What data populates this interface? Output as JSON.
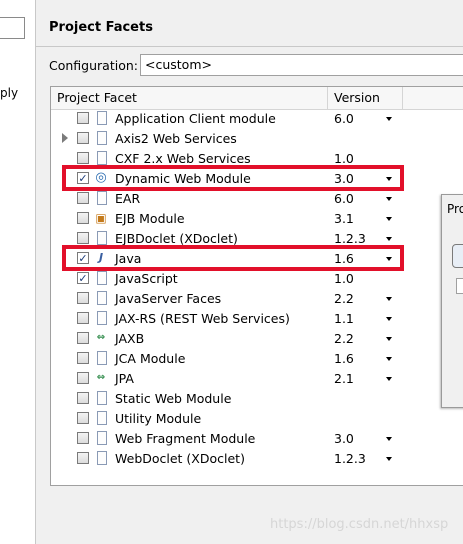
{
  "left_panel": {
    "partial_text": "ply"
  },
  "page": {
    "title": "Project Facets"
  },
  "configuration": {
    "label": "Configuration:",
    "value": "<custom>"
  },
  "table": {
    "headers": {
      "facet": "Project Facet",
      "version": "Version"
    },
    "rows": [
      {
        "label": "Application Client module",
        "version": "6.0",
        "checked": false,
        "icon": "doc-icon",
        "dropdown": true
      },
      {
        "label": "Axis2 Web Services",
        "version": "",
        "checked": false,
        "icon": "doc-icon",
        "expandable": true
      },
      {
        "label": "CXF 2.x Web Services",
        "version": "1.0",
        "checked": false,
        "icon": "doc-icon"
      },
      {
        "label": "Dynamic Web Module",
        "version": "3.0",
        "checked": true,
        "icon": "web-module-icon",
        "dropdown": true,
        "highlighted": true
      },
      {
        "label": "EAR",
        "version": "6.0",
        "checked": false,
        "icon": "doc-icon",
        "dropdown": true
      },
      {
        "label": "EJB Module",
        "version": "3.1",
        "checked": false,
        "icon": "ejb-icon",
        "dropdown": true
      },
      {
        "label": "EJBDoclet (XDoclet)",
        "version": "1.2.3",
        "checked": false,
        "icon": "doc-icon",
        "dropdown": true
      },
      {
        "label": "Java",
        "version": "1.6",
        "checked": true,
        "icon": "java-icon",
        "dropdown": true,
        "highlighted": true
      },
      {
        "label": "JavaScript",
        "version": "1.0",
        "checked": true,
        "icon": "doc-icon"
      },
      {
        "label": "JavaServer Faces",
        "version": "2.2",
        "checked": false,
        "icon": "doc-icon",
        "dropdown": true
      },
      {
        "label": "JAX-RS (REST Web Services)",
        "version": "1.1",
        "checked": false,
        "icon": "doc-icon",
        "dropdown": true
      },
      {
        "label": "JAXB",
        "version": "2.2",
        "checked": false,
        "icon": "jaxb-icon",
        "dropdown": true
      },
      {
        "label": "JCA Module",
        "version": "1.6",
        "checked": false,
        "icon": "doc-icon",
        "dropdown": true
      },
      {
        "label": "JPA",
        "version": "2.1",
        "checked": false,
        "icon": "jaxb-icon",
        "dropdown": true
      },
      {
        "label": "Static Web Module",
        "version": "",
        "checked": false,
        "icon": "doc-icon"
      },
      {
        "label": "Utility Module",
        "version": "",
        "checked": false,
        "icon": "doc-icon"
      },
      {
        "label": "Web Fragment Module",
        "version": "3.0",
        "checked": false,
        "icon": "doc-icon",
        "dropdown": true
      },
      {
        "label": "WebDoclet (XDoclet)",
        "version": "1.2.3",
        "checked": false,
        "icon": "doc-icon",
        "dropdown": true
      }
    ]
  },
  "side_dialog": {
    "partial_title": "Pro"
  },
  "watermark": "https://blog.csdn.net/hhxsp",
  "colors": {
    "highlight": "#e2102a"
  }
}
